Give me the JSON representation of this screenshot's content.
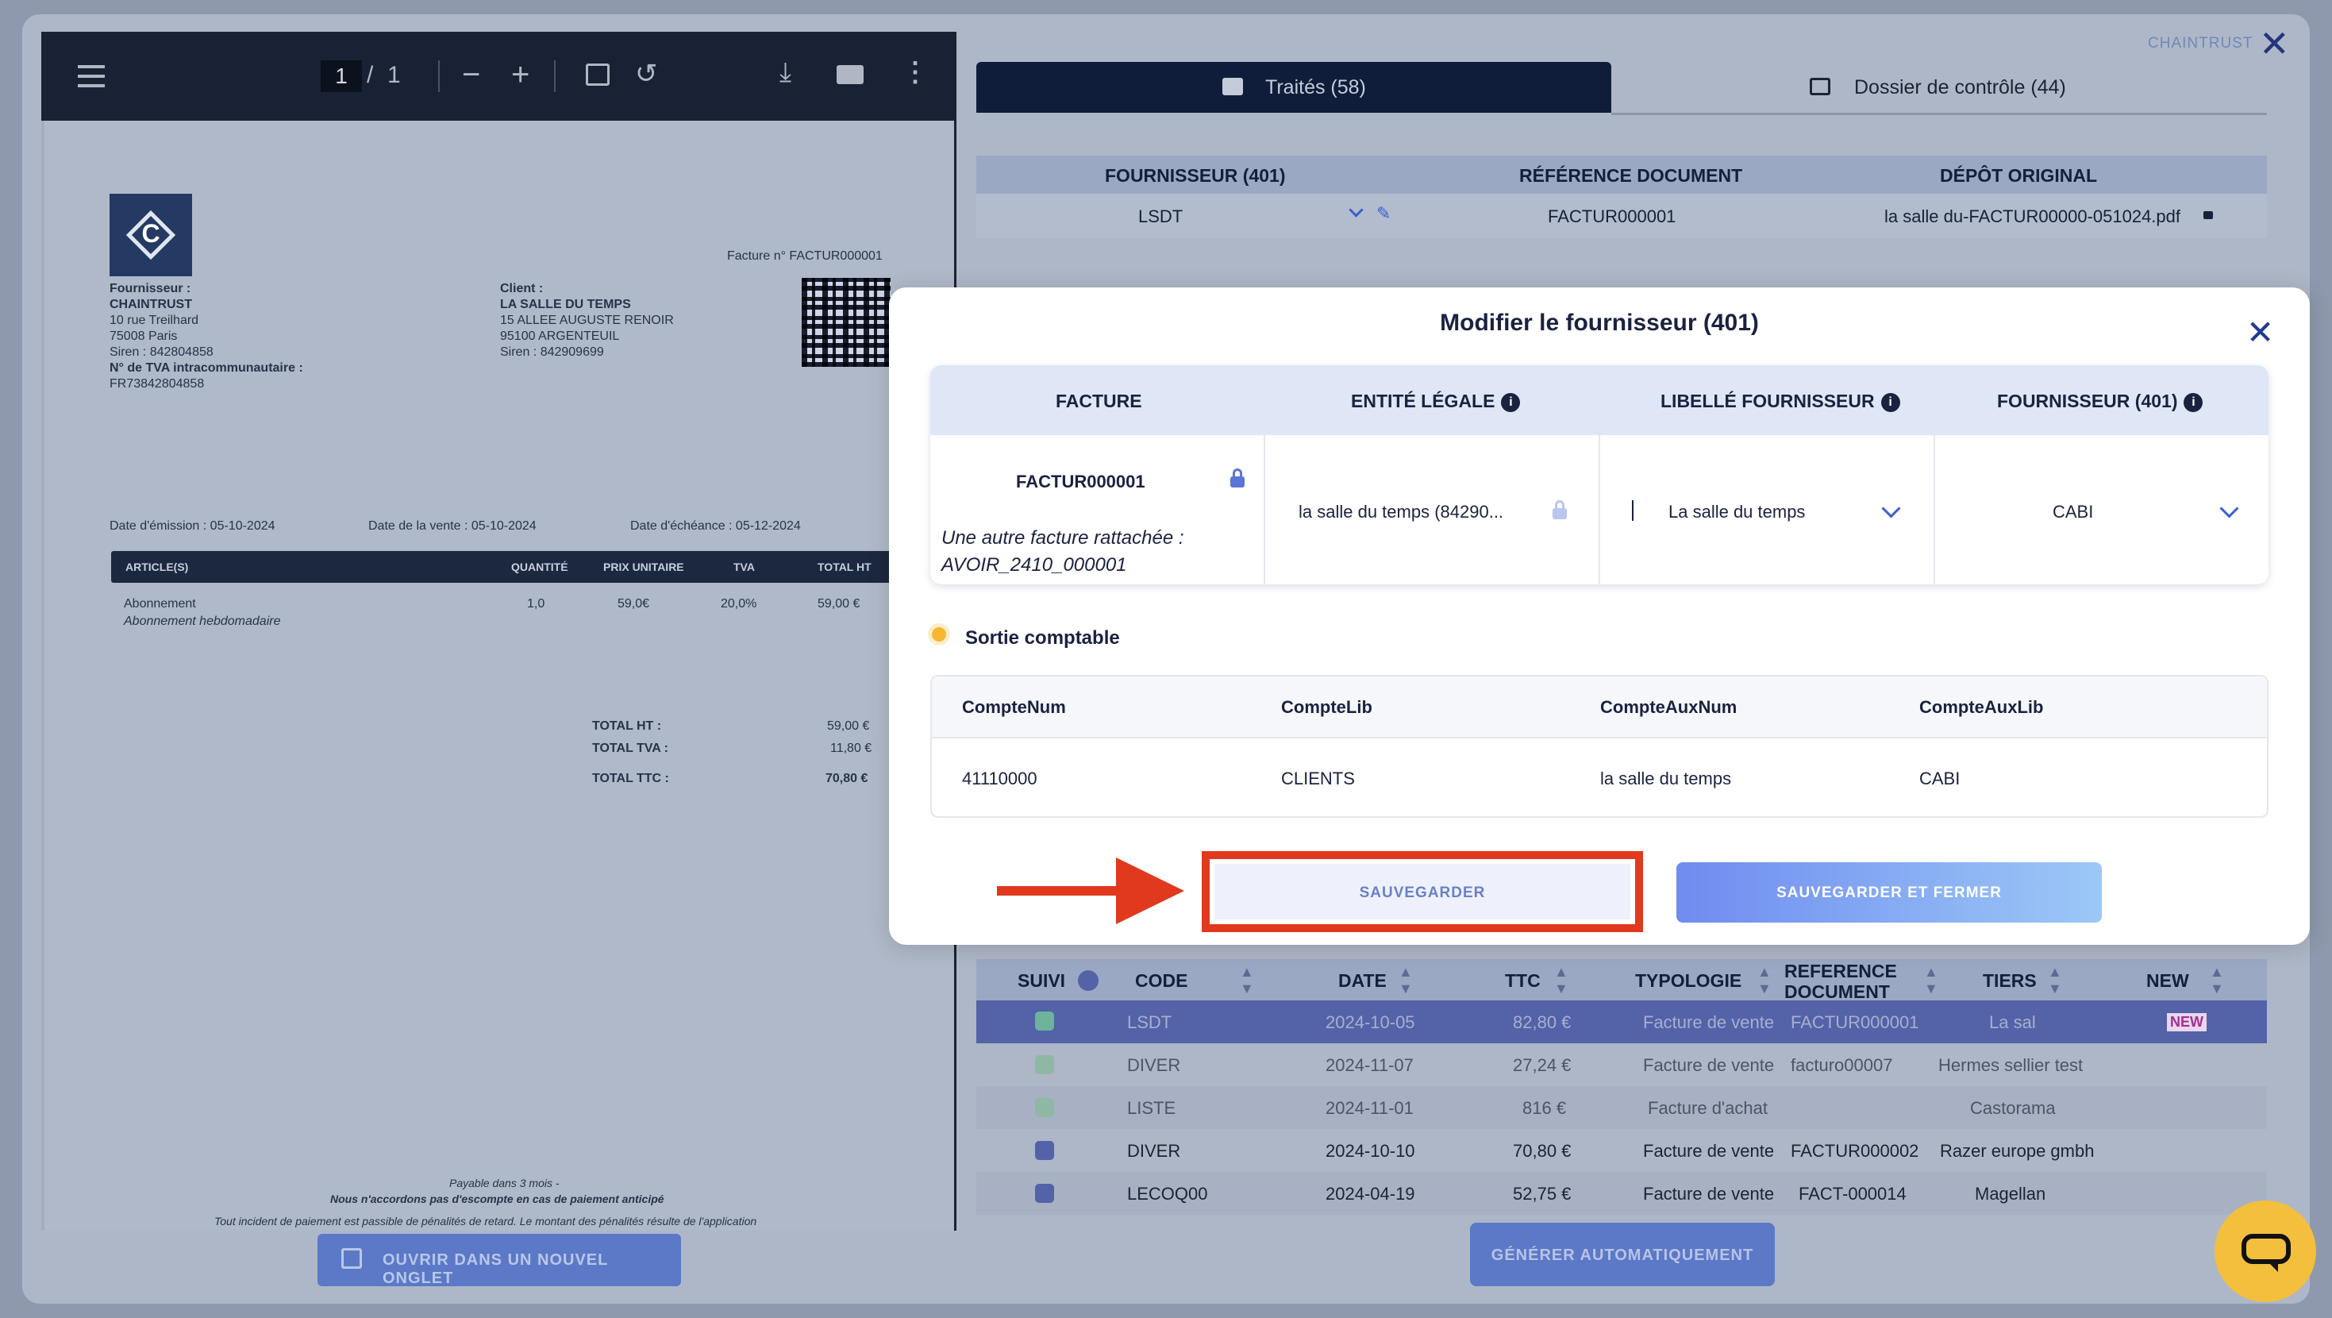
{
  "viewer": {
    "page_current": "1",
    "page_sep": "/",
    "page_total": "1",
    "open_new_tab": "OUVRIR DANS UN NOUVEL ONGLET"
  },
  "invoice": {
    "number_label": "Facture n° FACTUR000001",
    "supplier_label": "Fournisseur :",
    "supplier_name": "CHAINTRUST",
    "supplier_addr1": "10 rue Treilhard",
    "supplier_addr2": "75008 Paris",
    "supplier_siren": "Siren : 842804858",
    "supplier_tva_label": "N° de TVA intracommunautaire :",
    "supplier_tva": "FR73842804858",
    "client_label": "Client :",
    "client_name": "LA SALLE DU TEMPS",
    "client_addr1": "15 ALLEE AUGUSTE RENOIR",
    "client_addr2": "95100 ARGENTEUIL",
    "client_siren": "Siren : 842909699",
    "date_emission": "Date d'émission : 05-10-2024",
    "date_vente": "Date de la vente : 05-10-2024",
    "date_echeance": "Date d'échéance : 05-12-2024",
    "columns": [
      "ARTICLE(S)",
      "QUANTITÉ",
      "PRIX UNITAIRE",
      "TVA",
      "TOTAL HT"
    ],
    "line": {
      "article": "Abonnement",
      "desc": "Abonnement hebdomadaire",
      "qty": "1,0",
      "price": "59,0€",
      "tva": "20,0%",
      "total": "59,00 €"
    },
    "total_ht_label": "TOTAL HT :",
    "total_ht": "59,00 €",
    "total_tva_label": "TOTAL TVA :",
    "total_tva": "11,80 €",
    "total_ttc_label": "TOTAL TTC :",
    "total_ttc": "70,80 €",
    "footer1": "Payable dans 3 mois -",
    "footer2": "Nous n'accordons pas d'escompte en cas de paiement anticipé",
    "footer3": "Tout incident de paiement est passible de pénalités de retard. Le montant des pénalités résulte de l'application"
  },
  "header": {
    "brand": "CHAINTRUST"
  },
  "tabs": [
    {
      "label": "Traités (58)"
    },
    {
      "label": "Dossier de contrôle (44)"
    }
  ],
  "summary": {
    "headers": [
      "FOURNISSEUR (401)",
      "RÉFÉRENCE DOCUMENT",
      "DÉPÔT ORIGINAL"
    ],
    "fournisseur": "LSDT",
    "reference": "FACTUR000001",
    "depot": "la salle du-FACTUR00000-051024.pdf"
  },
  "modal": {
    "title": "Modifier le fournisseur (401)",
    "columns": [
      "FACTURE",
      "ENTITÉ LÉGALE",
      "LIBELLÉ FOURNISSEUR",
      "FOURNISSEUR (401)"
    ],
    "facture": "FACTUR000001",
    "attached_note": "Une autre facture rattachée :",
    "attached_ref": "AVOIR_2410_000001",
    "entite": "la salle du temps (84290...",
    "libelle": "La salle du temps",
    "fournisseur": "CABI",
    "sortie_title": "Sortie comptable",
    "sortie_headers": [
      "CompteNum",
      "CompteLib",
      "CompteAuxNum",
      "CompteAuxLib"
    ],
    "sortie_values": [
      "41110000",
      "CLIENTS",
      "la salle du temps",
      "CABI"
    ],
    "save": "SAUVEGARDER",
    "save_close": "SAUVEGARDER ET FERMER"
  },
  "table": {
    "headers": [
      "SUIVI",
      "CODE",
      "DATE",
      "TTC",
      "TYPOLOGIE",
      "REFERENCE",
      "DOCUMENT",
      "TIERS",
      "NEW"
    ],
    "rows": [
      {
        "code": "LSDT",
        "date": "2024-10-05",
        "ttc": "82,80 €",
        "typo": "Facture de vente",
        "ref": "FACTUR000001",
        "tiers": "La sal",
        "new": "NEW"
      },
      {
        "code": "DIVER",
        "date": "2024-11-07",
        "ttc": "27,24 €",
        "typo": "Facture de vente",
        "ref": "facturo00007",
        "tiers": "Hermes sellier test",
        "new": ""
      },
      {
        "code": "LISTE",
        "date": "2024-11-01",
        "ttc": "816 €",
        "typo": "Facture d'achat",
        "ref": "",
        "tiers": "Castorama",
        "new": ""
      },
      {
        "code": "DIVER",
        "date": "2024-10-10",
        "ttc": "70,80 €",
        "typo": "Facture de vente",
        "ref": "FACTUR000002",
        "tiers": "Razer europe gmbh",
        "new": ""
      },
      {
        "code": "LECOQ00",
        "date": "2024-04-19",
        "ttc": "52,75 €",
        "typo": "Facture de vente",
        "ref": "FACT-000014",
        "tiers": "Magellan",
        "new": ""
      }
    ]
  },
  "generate": "GÉNÉRER AUTOMATIQUEMENT"
}
